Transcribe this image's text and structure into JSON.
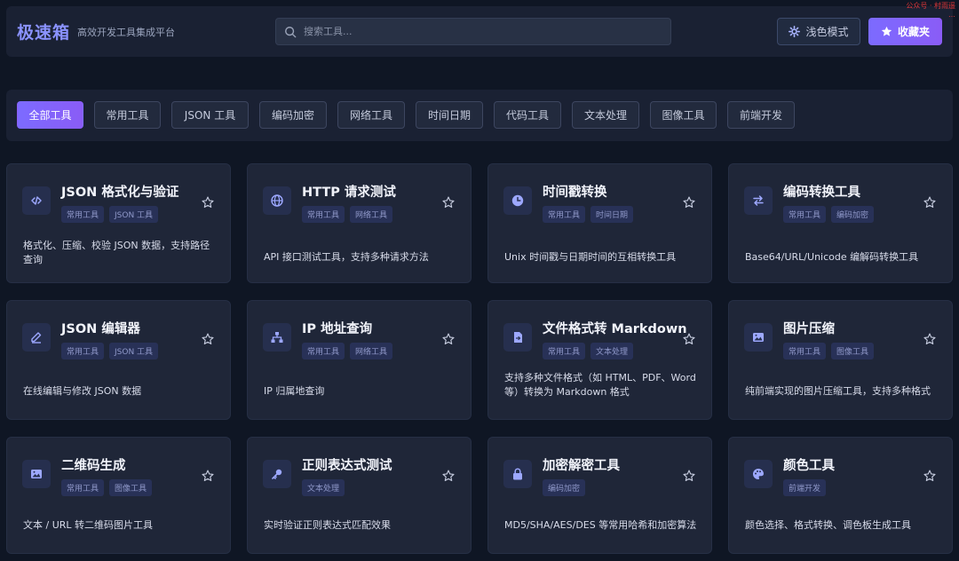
{
  "header": {
    "brand": "极速箱",
    "tagline": "高效开发工具集成平台",
    "search_placeholder": "搜索工具...",
    "theme_label": "浅色模式",
    "favorites_label": "收藏夹",
    "watermark_line1": "公众号 · 村雨遥",
    "watermark_line2": "…"
  },
  "categories": [
    {
      "label": "全部工具",
      "active": true
    },
    {
      "label": "常用工具",
      "active": false
    },
    {
      "label": "JSON 工具",
      "active": false
    },
    {
      "label": "编码加密",
      "active": false
    },
    {
      "label": "网络工具",
      "active": false
    },
    {
      "label": "时间日期",
      "active": false
    },
    {
      "label": "代码工具",
      "active": false
    },
    {
      "label": "文本处理",
      "active": false
    },
    {
      "label": "图像工具",
      "active": false
    },
    {
      "label": "前端开发",
      "active": false
    }
  ],
  "tools": [
    {
      "title": "JSON 格式化与验证",
      "icon": "code-icon",
      "tags": [
        "常用工具",
        "JSON 工具"
      ],
      "desc": "格式化、压缩、校验 JSON 数据，支持路径查询"
    },
    {
      "title": "HTTP 请求测试",
      "icon": "globe-icon",
      "tags": [
        "常用工具",
        "网络工具"
      ],
      "desc": "API 接口测试工具，支持多种请求方法"
    },
    {
      "title": "时间戳转换",
      "icon": "clock-icon",
      "tags": [
        "常用工具",
        "时间日期"
      ],
      "desc": "Unix 时间戳与日期时间的互相转换工具"
    },
    {
      "title": "编码转换工具",
      "icon": "swap-icon",
      "tags": [
        "常用工具",
        "编码加密"
      ],
      "desc": "Base64/URL/Unicode 编解码转换工具"
    },
    {
      "title": "JSON 编辑器",
      "icon": "edit-icon",
      "tags": [
        "常用工具",
        "JSON 工具"
      ],
      "desc": "在线编辑与修改 JSON 数据"
    },
    {
      "title": "IP 地址查询",
      "icon": "network-icon",
      "tags": [
        "常用工具",
        "网络工具"
      ],
      "desc": "IP 归属地查询"
    },
    {
      "title": "文件格式转 Markdown",
      "icon": "file-convert-icon",
      "tags": [
        "常用工具",
        "文本处理"
      ],
      "desc": "支持多种文件格式（如 HTML、PDF、Word 等）转换为 Markdown 格式"
    },
    {
      "title": "图片压缩",
      "icon": "image-icon",
      "tags": [
        "常用工具",
        "图像工具"
      ],
      "desc": "纯前端实现的图片压缩工具，支持多种格式"
    },
    {
      "title": "二维码生成",
      "icon": "image-icon",
      "tags": [
        "常用工具",
        "图像工具"
      ],
      "desc": "文本 / URL 转二维码图片工具"
    },
    {
      "title": "正则表达式测试",
      "icon": "key-icon",
      "tags": [
        "文本处理"
      ],
      "desc": "实时验证正则表达式匹配效果"
    },
    {
      "title": "加密解密工具",
      "icon": "lock-icon",
      "tags": [
        "编码加密"
      ],
      "desc": "MD5/SHA/AES/DES 等常用哈希和加密算法"
    },
    {
      "title": "颜色工具",
      "icon": "palette-icon",
      "tags": [
        "前端开发"
      ],
      "desc": "颜色选择、格式转换、调色板生成工具"
    }
  ],
  "colors": {
    "accent": "#7c6bff",
    "background": "#0f1624",
    "card": "#1f2638"
  }
}
